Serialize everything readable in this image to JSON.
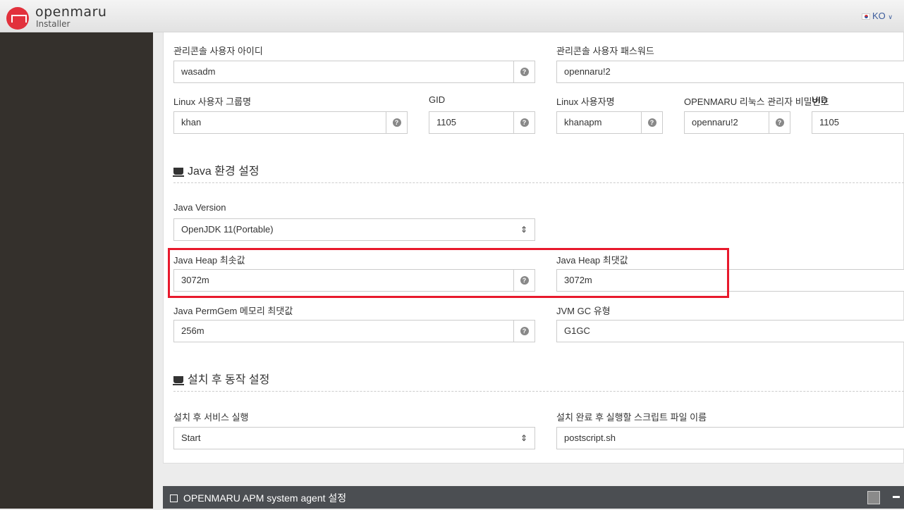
{
  "header": {
    "brand": "openmaru",
    "subtitle": "Installer",
    "language": "KO"
  },
  "console": {
    "user_label": "관리콘솔 사용자 아이디",
    "user_value": "wasadm",
    "pw_label": "관리콘솔 사용자 패스워드",
    "pw_value": "opennaru!2"
  },
  "linux": {
    "group_label": "Linux 사용자 그룹명",
    "group_value": "khan",
    "gid_label": "GID",
    "gid_value": "1105",
    "user_label": "Linux 사용자명",
    "user_value": "khanapm",
    "admin_pw_label": "OPENMARU 리눅스 관리자 비밀번호",
    "admin_pw_value": "opennaru!2",
    "uid_label": "UID",
    "uid_value": "1105"
  },
  "java": {
    "section_title": "Java 환경 설정",
    "version_label": "Java Version",
    "version_value": "OpenJDK 11(Portable)",
    "heap_min_label": "Java Heap 최솟값",
    "heap_min_value": "3072m",
    "heap_max_label": "Java Heap 최댓값",
    "heap_max_value": "3072m",
    "permgen_label": "Java PermGem 메모리 최댓값",
    "permgen_value": "256m",
    "gc_label": "JVM GC 유형",
    "gc_value": "G1GC"
  },
  "post": {
    "section_title": "설치 후 동작 설정",
    "service_label": "설치 후 서비스 실행",
    "service_value": "Start",
    "script_label": "설치 완료 후 실행할 스크립트 파일 이름",
    "script_value": "postscript.sh"
  },
  "agent_bar": {
    "title": "OPENMARU APM system agent 설정"
  },
  "help_glyph": "?"
}
